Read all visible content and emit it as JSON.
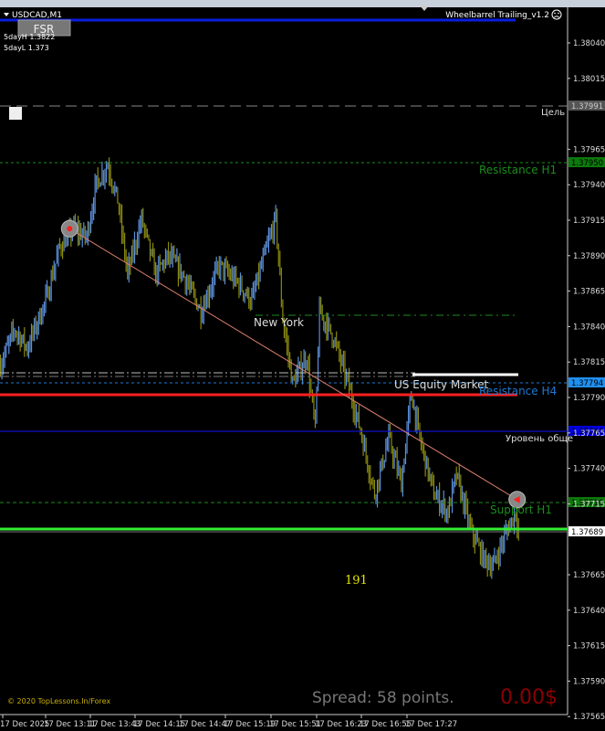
{
  "window": {
    "symbol_label": "USDCAD,M1",
    "expert_name": "Wheelbarrel Trailing_v1.2",
    "expert_status_icon": "sad-face-icon"
  },
  "fsr_button": {
    "label": "FSR"
  },
  "info": {
    "five_day_high": "5dayH 1.3822",
    "five_day_low": "5dayL 1.373"
  },
  "footer": {
    "copyright": "© 2020 TopLessons.In/Forex",
    "spread": "Spread: 58 points.",
    "profit": "0.00$"
  },
  "counter": {
    "value": "191"
  },
  "colors": {
    "bull_bar": "#5b8fd9",
    "bear_bar": "#8a8a10",
    "trendline": "#e08070",
    "resistance_h1": "#1c8c1c",
    "resistance_h4": "#1e78d2",
    "support_h1": "#1c8c1c",
    "current_price_line": "#33ee33",
    "red_level": "#ff2020",
    "blue_level": "#1010c8"
  },
  "levels": {
    "target": {
      "label": "Цель",
      "price": "1.37991"
    },
    "resistance_h1": {
      "label": "Resistance H1",
      "price": "1.37950"
    },
    "resistance_h4": {
      "label": "Resistance H4",
      "price": "1.37794"
    },
    "general_level": {
      "label": "Уровень обще",
      "price": "1.37760"
    },
    "support_h1": {
      "label": "Support H1",
      "price": "1.37710"
    },
    "current": {
      "price": "1.37689"
    },
    "new_york": {
      "label": "New York"
    },
    "us_equity": {
      "label": "US Equity Market"
    }
  },
  "price_axis": [
    "1.38040",
    "1.38015",
    "1.37965",
    "1.37940",
    "1.37915",
    "1.37890",
    "1.37865",
    "1.37840",
    "1.37815",
    "1.37790",
    "1.37765",
    "1.37740",
    "1.37715",
    "1.37665",
    "1.37640",
    "1.37615",
    "1.37590",
    "1.37565"
  ],
  "time_axis": [
    "17 Dec 2025",
    "17 Dec 13:11",
    "17 Dec 13:43",
    "17 Dec 14:15",
    "17 Dec 14:47",
    "17 Dec 15:19",
    "17 Dec 15:51",
    "17 Dec 16:23",
    "17 Dec 16:55",
    "17 Dec 17:27"
  ],
  "chart_data": {
    "type": "bar",
    "symbol": "USDCAD",
    "timeframe": "M1",
    "ylim": [
      1.3755,
      1.3807
    ],
    "price_path": [
      [
        "12:39",
        1.37813
      ],
      [
        "12:49",
        1.37838
      ],
      [
        "12:58",
        1.37825
      ],
      [
        "13:11",
        1.37858
      ],
      [
        "13:21",
        1.37896
      ],
      [
        "13:31",
        1.37909
      ],
      [
        "13:40",
        1.37903
      ],
      [
        "13:47",
        1.37941
      ],
      [
        "13:55",
        1.37954
      ],
      [
        "14:02",
        1.37929
      ],
      [
        "14:09",
        1.37877
      ],
      [
        "14:19",
        1.37916
      ],
      [
        "14:29",
        1.37877
      ],
      [
        "14:38",
        1.3789
      ],
      [
        "14:48",
        1.37877
      ],
      [
        "15:01",
        1.37851
      ],
      [
        "15:14",
        1.37883
      ],
      [
        "15:27",
        1.37871
      ],
      [
        "15:37",
        1.37858
      ],
      [
        "15:46",
        1.3789
      ],
      [
        "15:54",
        1.37916
      ],
      [
        "15:59",
        1.37845
      ],
      [
        "16:06",
        1.378
      ],
      [
        "16:16",
        1.37819
      ],
      [
        "16:22",
        1.37767
      ],
      [
        "16:25",
        1.37851
      ],
      [
        "16:35",
        1.37832
      ],
      [
        "16:45",
        1.378
      ],
      [
        "16:54",
        1.37767
      ],
      [
        "17:04",
        1.37722
      ],
      [
        "17:14",
        1.37761
      ],
      [
        "17:23",
        1.37729
      ],
      [
        "17:30",
        1.37793
      ],
      [
        "17:36",
        1.37761
      ],
      [
        "17:46",
        1.37722
      ],
      [
        "17:56",
        1.37709
      ],
      [
        "18:02",
        1.37735
      ],
      [
        "18:12",
        1.37697
      ],
      [
        "18:21",
        1.37677
      ],
      [
        "18:28",
        1.37671
      ],
      [
        "18:38",
        1.37697
      ],
      [
        "18:44",
        1.37709
      ],
      [
        "18:47",
        1.3769
      ]
    ],
    "trendline": [
      [
        "13:28",
        1.37909
      ],
      [
        "18:45",
        1.37718
      ]
    ]
  }
}
